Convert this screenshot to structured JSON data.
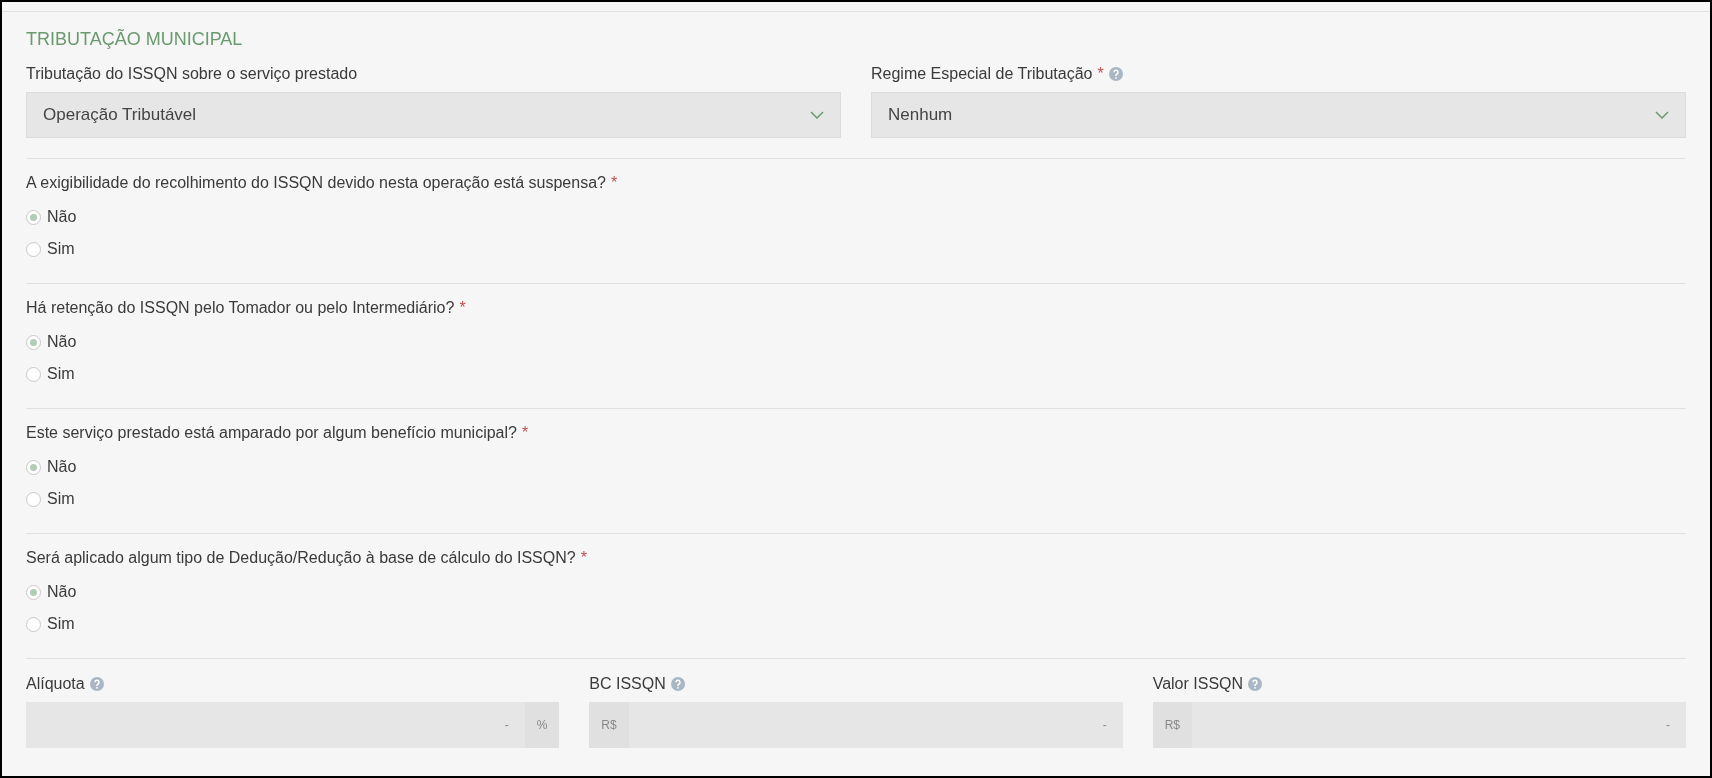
{
  "section_title": "TRIBUTAÇÃO MUNICIPAL",
  "selects": [
    {
      "label": "Tributação do ISSQN sobre o serviço prestado",
      "help": false,
      "value": "Operação Tributável"
    },
    {
      "label": "Regime Especial de Tributação",
      "required_mark": "*",
      "help": true,
      "value": "Nenhum"
    }
  ],
  "questions": [
    {
      "text": "A exigibilidade do recolhimento do ISSQN devido nesta operação está suspensa?",
      "required_mark": "*",
      "options": [
        {
          "label": "Não",
          "selected": true
        },
        {
          "label": "Sim",
          "selected": false
        }
      ]
    },
    {
      "text": "Há retenção do ISSQN pelo Tomador ou pelo Intermediário?",
      "required_mark": "*",
      "options": [
        {
          "label": "Não",
          "selected": true
        },
        {
          "label": "Sim",
          "selected": false
        }
      ]
    },
    {
      "text": "Este serviço prestado está amparado por algum benefício municipal?",
      "required_mark": "*",
      "options": [
        {
          "label": "Não",
          "selected": true
        },
        {
          "label": "Sim",
          "selected": false
        }
      ]
    },
    {
      "text": "Será aplicado algum tipo de Dedução/Redução à base de cálculo do ISSQN?",
      "required_mark": "*",
      "options": [
        {
          "label": "Não",
          "selected": true
        },
        {
          "label": "Sim",
          "selected": false
        }
      ]
    }
  ],
  "amounts": [
    {
      "label": "Alíquota",
      "help": true,
      "placeholder": "-",
      "suffix": "%"
    },
    {
      "label": "BC ISSQN",
      "help": true,
      "prefix": "R$",
      "placeholder": "-"
    },
    {
      "label": "Valor ISSQN",
      "help": true,
      "prefix": "R$",
      "placeholder": "-"
    }
  ]
}
